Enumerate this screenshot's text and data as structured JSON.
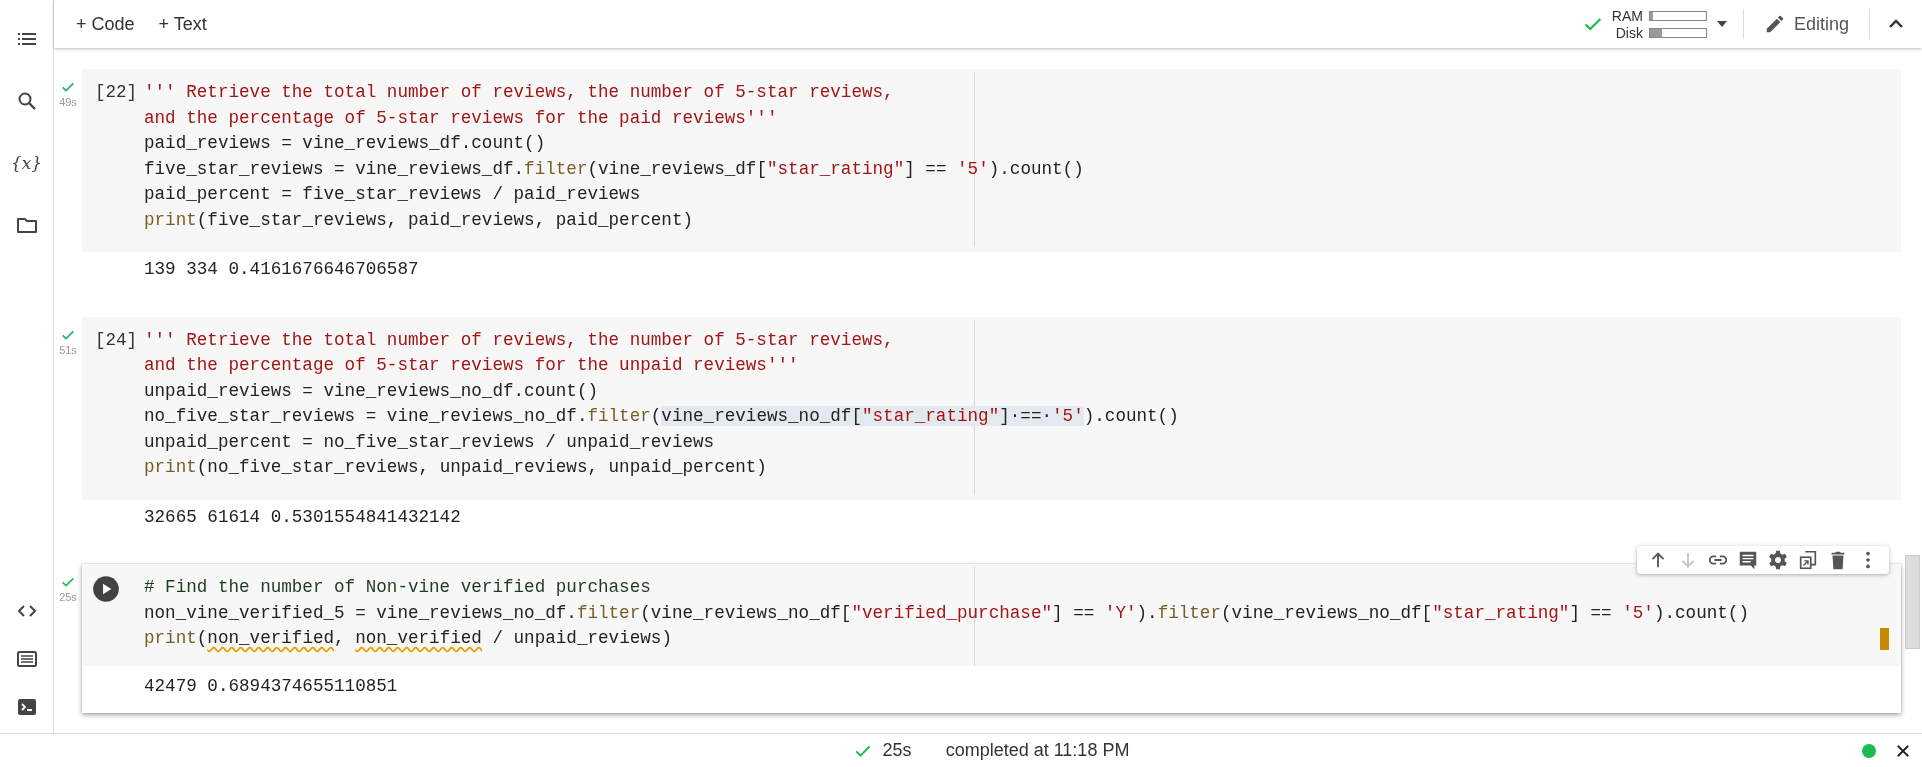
{
  "topbar": {
    "add_buttons": [
      "+ Code",
      "+ Text"
    ],
    "runtime_connected": true,
    "resources": [
      {
        "label": "RAM",
        "level": 0.05
      },
      {
        "label": "Disk",
        "level": 0.22
      }
    ],
    "mode": "Editing"
  },
  "sidebar": {
    "top": [
      {
        "kind": "toc"
      },
      {
        "kind": "search"
      },
      {
        "kind": "variables",
        "text": "{x}"
      },
      {
        "kind": "files"
      }
    ],
    "bottom": [
      {
        "kind": "snippets"
      },
      {
        "kind": "command-palette"
      },
      {
        "kind": "terminal"
      }
    ]
  },
  "cells": [
    {
      "execution_count": "[22]",
      "succeeded": true,
      "duration": "49s",
      "selected": false,
      "code": [
        [
          {
            "text": "''' Retrieve the total number of reviews, the number of 5-star reviews,",
            "kind": "string"
          }
        ],
        [
          {
            "text": "and the percentage of 5-star reviews for the paid reviews'''",
            "kind": "string"
          }
        ],
        [
          "paid_reviews = vine_reviews_df.count()"
        ],
        [
          "five_star_reviews = vine_reviews_df.",
          {
            "text": "filter",
            "kind": "function"
          },
          "(vine_reviews_df[",
          {
            "text": "\"star_rating\"",
            "kind": "string"
          },
          "] == ",
          {
            "text": "'5'",
            "kind": "string"
          },
          ").count()"
        ],
        [
          "paid_percent = five_star_reviews / paid_reviews"
        ],
        [
          {
            "text": "print",
            "kind": "function"
          },
          "(five_star_reviews, paid_reviews, paid_percent)"
        ]
      ],
      "output": "139 334 0.4161676646706587"
    },
    {
      "execution_count": "[24]",
      "succeeded": true,
      "duration": "51s",
      "selected": false,
      "code": [
        [
          {
            "text": "''' Retrieve the total number of reviews, the number of 5-star reviews,",
            "kind": "string"
          }
        ],
        [
          {
            "text": "and the percentage of 5-star reviews for the unpaid reviews'''",
            "kind": "string"
          }
        ],
        [
          "unpaid_reviews = vine_reviews_no_df.count()"
        ],
        [
          "no_five_star_reviews = vine_reviews_no_df.",
          {
            "text": "filter",
            "kind": "function"
          },
          "(",
          {
            "text": "vine_reviews_no_df[",
            "kind": "plain",
            "highlighted": true
          },
          {
            "text": "\"star_rating\"",
            "kind": "string",
            "highlighted": true
          },
          {
            "text": "]·==·",
            "kind": "plain",
            "highlighted": true
          },
          {
            "text": "'5'",
            "kind": "string",
            "highlighted": true
          },
          ").count()"
        ],
        [
          "unpaid_percent = no_five_star_reviews / unpaid_reviews"
        ],
        [
          {
            "text": "print",
            "kind": "function"
          },
          "(no_five_star_reviews, unpaid_reviews, unpaid_percent)"
        ]
      ],
      "output": "32665 61614 0.5301554841432142"
    },
    {
      "succeeded": true,
      "duration": "25s",
      "selected": true,
      "code": [
        [
          {
            "text": "# Find the number of Non-vine verified purchases",
            "kind": "comment"
          }
        ],
        [
          "non_vine_verified_5 = vine_reviews_no_df.",
          {
            "text": "filter",
            "kind": "function"
          },
          "(vine_reviews_no_df[",
          {
            "text": "\"verified_purchase\"",
            "kind": "string"
          },
          "] == ",
          {
            "text": "'Y'",
            "kind": "string"
          },
          ").",
          {
            "text": "filter",
            "kind": "function"
          },
          "(vine_reviews_no_df[",
          {
            "text": "\"star_rating\"",
            "kind": "string"
          },
          "] == ",
          {
            "text": "'5'",
            "kind": "string"
          },
          ").count()"
        ],
        [
          {
            "text": "print",
            "kind": "function"
          },
          "(",
          {
            "text": "non_verified",
            "kind": "warning"
          },
          ", ",
          {
            "text": "non_verified",
            "kind": "warning"
          },
          " / unpaid_reviews)"
        ]
      ],
      "output": "42479 0.6894374655110851",
      "toolbar": [
        {
          "kind": "move-up",
          "disabled": false
        },
        {
          "kind": "move-down",
          "disabled": true
        },
        {
          "kind": "link",
          "disabled": false
        },
        {
          "kind": "comment",
          "disabled": false
        },
        {
          "kind": "settings",
          "disabled": false
        },
        {
          "kind": "mirror",
          "disabled": false
        },
        {
          "kind": "delete",
          "disabled": false
        },
        {
          "kind": "more",
          "disabled": false
        }
      ]
    }
  ],
  "status_bar": {
    "succeeded": true,
    "duration": "25s",
    "message": "completed at 11:18 PM",
    "connected": true
  }
}
